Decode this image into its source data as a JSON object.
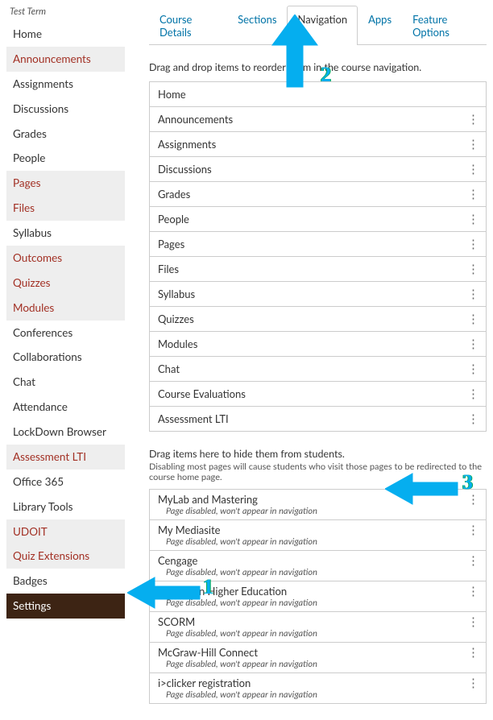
{
  "term": "Test Term",
  "sidebar": [
    {
      "label": "Home",
      "red": false,
      "hover": false
    },
    {
      "label": "Announcements",
      "red": true,
      "hover": true
    },
    {
      "label": "Assignments",
      "red": false,
      "hover": false
    },
    {
      "label": "Discussions",
      "red": false,
      "hover": false
    },
    {
      "label": "Grades",
      "red": false,
      "hover": false
    },
    {
      "label": "People",
      "red": false,
      "hover": false
    },
    {
      "label": "Pages",
      "red": true,
      "hover": true
    },
    {
      "label": "Files",
      "red": true,
      "hover": true
    },
    {
      "label": "Syllabus",
      "red": false,
      "hover": false
    },
    {
      "label": "Outcomes",
      "red": true,
      "hover": true
    },
    {
      "label": "Quizzes",
      "red": true,
      "hover": true
    },
    {
      "label": "Modules",
      "red": true,
      "hover": true
    },
    {
      "label": "Conferences",
      "red": false,
      "hover": false
    },
    {
      "label": "Collaborations",
      "red": false,
      "hover": false
    },
    {
      "label": "Chat",
      "red": false,
      "hover": false
    },
    {
      "label": "Attendance",
      "red": false,
      "hover": false
    },
    {
      "label": "LockDown Browser",
      "red": false,
      "hover": false
    },
    {
      "label": "Assessment LTI",
      "red": true,
      "hover": true
    },
    {
      "label": "Office 365",
      "red": false,
      "hover": false
    },
    {
      "label": "Library Tools",
      "red": false,
      "hover": false
    },
    {
      "label": "UDOIT",
      "red": true,
      "hover": true
    },
    {
      "label": "Quiz Extensions",
      "red": true,
      "hover": true
    },
    {
      "label": "Badges",
      "red": false,
      "hover": false
    },
    {
      "label": "Settings",
      "red": false,
      "active": true
    }
  ],
  "tabs": [
    {
      "label": "Course Details",
      "active": false
    },
    {
      "label": "Sections",
      "active": false
    },
    {
      "label": "Navigation",
      "active": true
    },
    {
      "label": "Apps",
      "active": false
    },
    {
      "label": "Feature Options",
      "active": false
    }
  ],
  "desc": "Drag and drop items to reorder them in the course navigation.",
  "enabled": [
    "Home",
    "Announcements",
    "Assignments",
    "Discussions",
    "Grades",
    "People",
    "Pages",
    "Files",
    "Syllabus",
    "Quizzes",
    "Modules",
    "Chat",
    "Course Evaluations",
    "Assessment LTI"
  ],
  "hide_desc1": "Drag items here to hide them from students.",
  "hide_desc2": "Disabling most pages will cause students who visit those pages to be redirected to the course home page.",
  "disabled_sub": "Page disabled, won't appear in navigation",
  "disabled": [
    "MyLab and Mastering",
    "My Mediasite",
    "Cengage",
    "Macmillan Higher Education",
    "SCORM",
    "McGraw-Hill Connect",
    "i>clicker registration"
  ],
  "annotations": {
    "one": "1",
    "two": "2",
    "three": "3"
  }
}
